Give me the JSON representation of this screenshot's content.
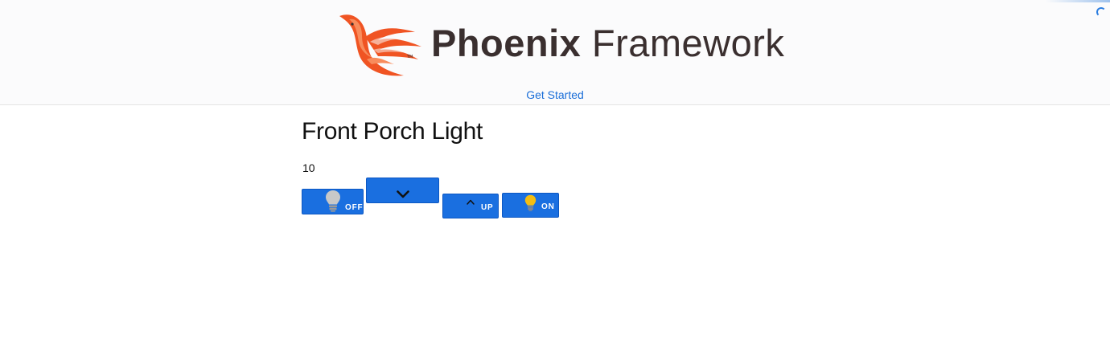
{
  "header": {
    "brand_bold": "Phoenix",
    "brand_light": "Framework",
    "get_started_label": "Get Started",
    "brand_color": "#f05423"
  },
  "main": {
    "title": "Front Porch Light",
    "level_value": "10"
  },
  "controls": {
    "off_label": "OFF",
    "up_label": "UP",
    "on_label": "ON",
    "button_color": "#1a6fe0",
    "bulb_off_color": "#c8c8c8",
    "bulb_on_color": "#f3bd11"
  }
}
